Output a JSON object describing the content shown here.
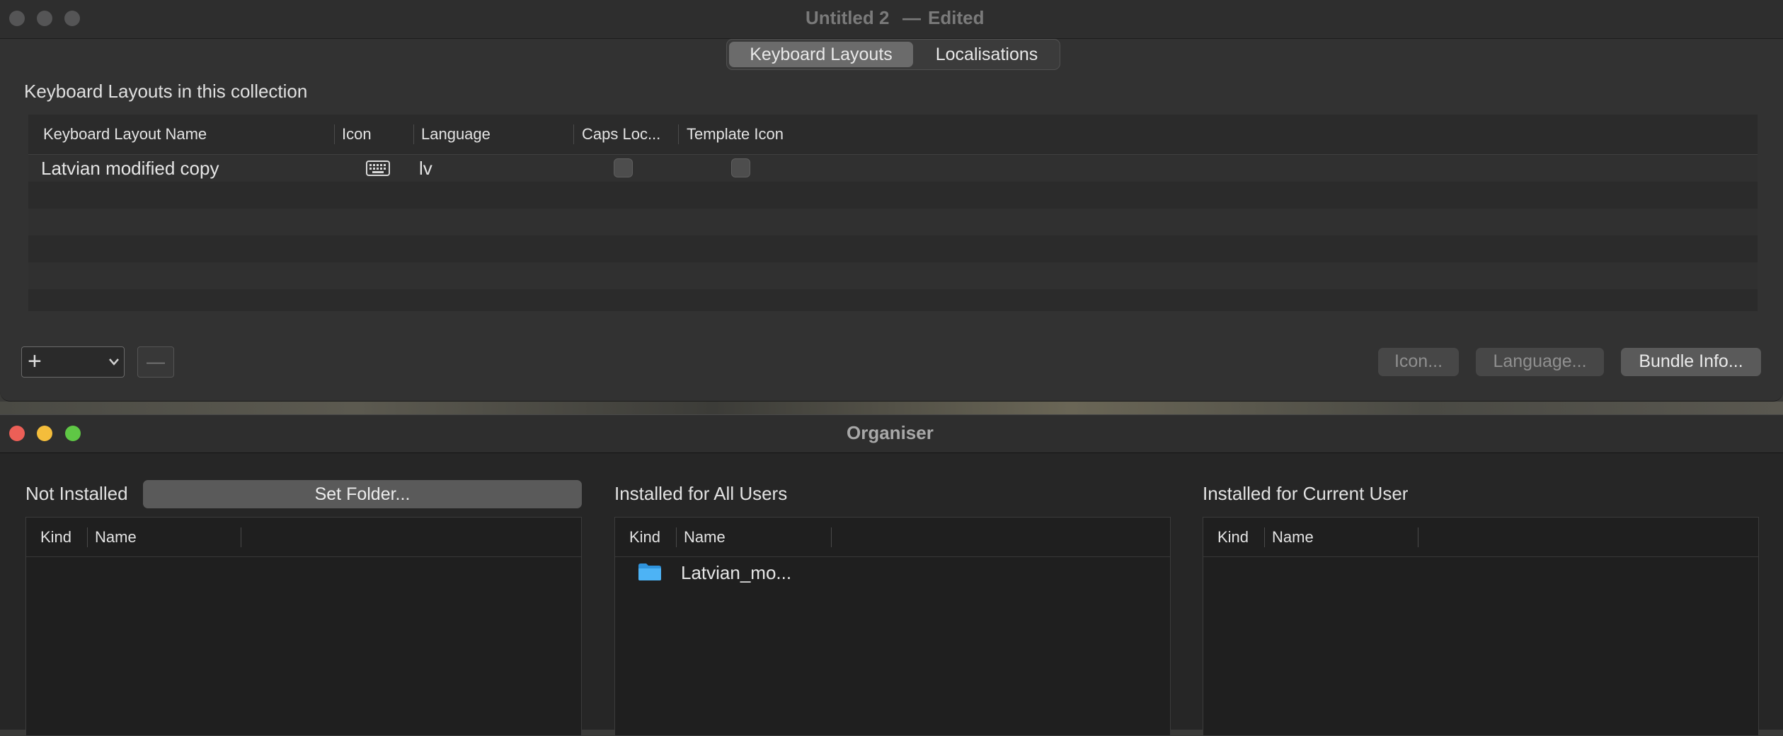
{
  "window1": {
    "title": "Untitled 2",
    "title_separator": "—",
    "title_status": "Edited",
    "tabs": [
      {
        "label": "Keyboard Layouts",
        "selected": true
      },
      {
        "label": "Localisations",
        "selected": false
      }
    ],
    "section_heading": "Keyboard Layouts in this collection",
    "table": {
      "columns": [
        "Keyboard Layout Name",
        "Icon",
        "Language",
        "Caps Loc...",
        "Template Icon"
      ],
      "rows": [
        {
          "name": "Latvian modified copy",
          "icon": "keyboard-icon",
          "language": "lv",
          "caps_lock": false,
          "template_icon": false
        }
      ]
    },
    "add_label": "+",
    "remove_label": "—",
    "buttons": {
      "icon": "Icon...",
      "language": "Language...",
      "bundle_info": "Bundle Info..."
    }
  },
  "window2": {
    "title": "Organiser",
    "not_installed": {
      "label": "Not Installed",
      "set_folder": "Set Folder...",
      "columns": [
        "Kind",
        "Name"
      ],
      "items": []
    },
    "all_users": {
      "label": "Installed for All Users",
      "columns": [
        "Kind",
        "Name"
      ],
      "items": [
        {
          "kind": "folder-icon",
          "name": "Latvian_mo..."
        }
      ]
    },
    "current_user": {
      "label": "Installed for Current User",
      "columns": [
        "Kind",
        "Name"
      ],
      "items": []
    }
  },
  "colors": {
    "window_bg": "#323232",
    "selected_tab": "#6b6b6b",
    "folder_blue": "#3aa7f0",
    "traffic_red": "#ec5f57",
    "traffic_yellow": "#f4bd3b",
    "traffic_green": "#5fc745"
  }
}
